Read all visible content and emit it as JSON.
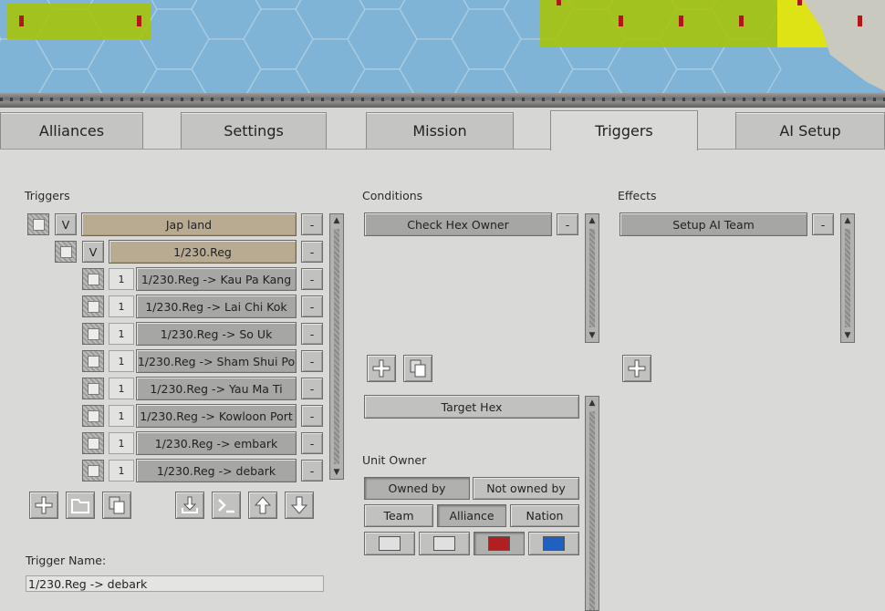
{
  "tabs": [
    {
      "label": "Alliances"
    },
    {
      "label": "Settings"
    },
    {
      "label": "Mission"
    },
    {
      "label": "Triggers",
      "active": true
    },
    {
      "label": "AI Setup"
    }
  ],
  "triggers": {
    "header": "Triggers",
    "groups": [
      {
        "check_label": "V",
        "label": "Jap land",
        "remove": "-"
      },
      {
        "check_label": "V",
        "label": "1/230.Reg",
        "remove": "-"
      }
    ],
    "items": [
      {
        "count": "1",
        "label": "1/230.Reg -> Kau Pa Kang",
        "remove": "-"
      },
      {
        "count": "1",
        "label": "1/230.Reg -> Lai Chi Kok",
        "remove": "-"
      },
      {
        "count": "1",
        "label": "1/230.Reg -> So Uk",
        "remove": "-"
      },
      {
        "count": "1",
        "label": "1/230.Reg -> Sham Shui Po",
        "remove": "-"
      },
      {
        "count": "1",
        "label": "1/230.Reg -> Yau Ma Ti",
        "remove": "-"
      },
      {
        "count": "1",
        "label": "1/230.Reg -> Kowloon Port",
        "remove": "-"
      },
      {
        "count": "1",
        "label": "1/230.Reg -> embark",
        "remove": "-"
      },
      {
        "count": "1",
        "label": "1/230.Reg -> debark",
        "remove": "-"
      }
    ],
    "name_label": "Trigger Name:",
    "name_value": "1/230.Reg -> debark"
  },
  "conditions": {
    "header": "Conditions",
    "items": [
      {
        "label": "Check Hex Owner",
        "remove": "-"
      }
    ],
    "target_button": "Target Hex",
    "unit_owner_label": "Unit Owner",
    "owned_by": "Owned by",
    "not_owned_by": "Not owned by",
    "team": "Team",
    "alliance": "Alliance",
    "nation": "Nation",
    "swatch_colors": [
      "#e0e0e0",
      "#e0e0e0",
      "#b02020",
      "#2060c0"
    ]
  },
  "effects": {
    "header": "Effects",
    "items": [
      {
        "label": "Setup AI Team",
        "remove": "-"
      }
    ]
  },
  "map": {
    "water_color": "#7fb4d6",
    "highlight_color": "#a8c400",
    "yellow_color": "#e8e800"
  }
}
